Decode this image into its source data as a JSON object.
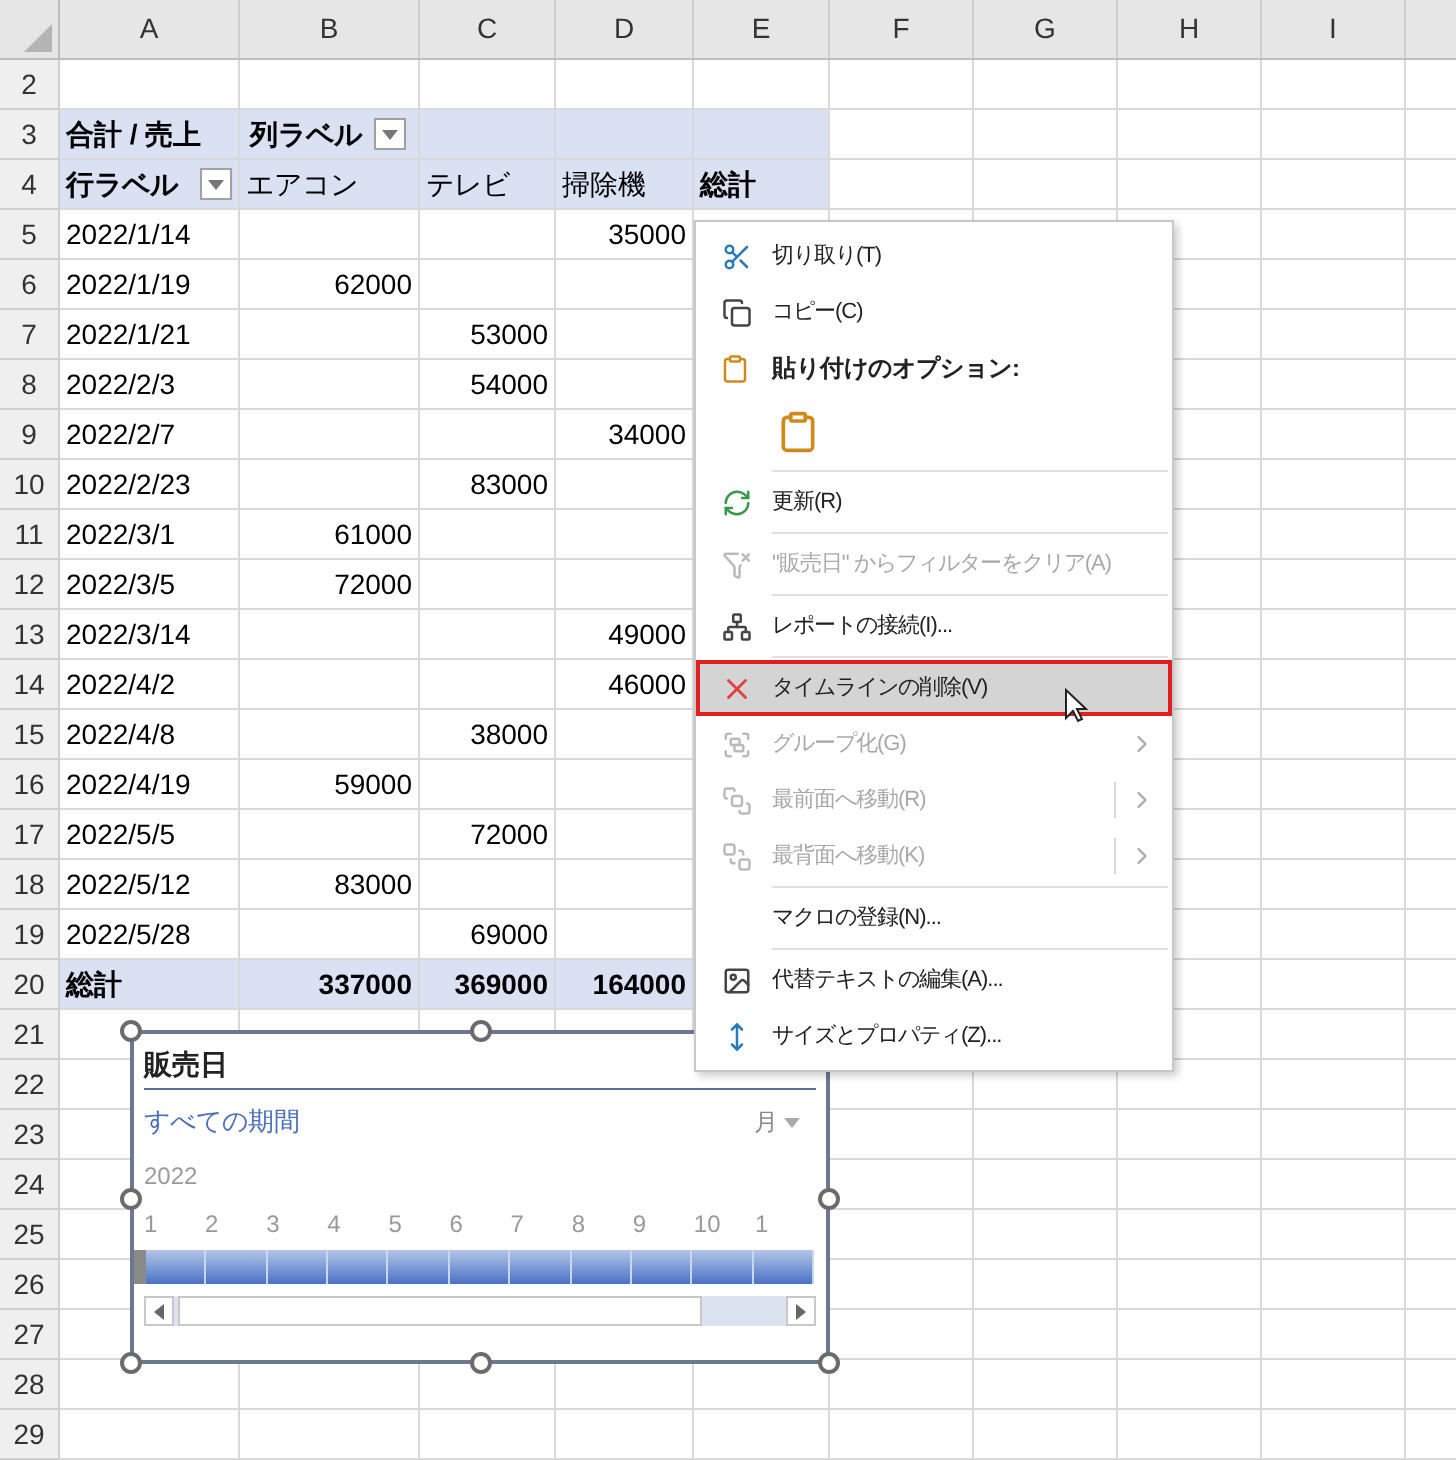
{
  "sheet": {
    "columns": [
      "A",
      "B",
      "C",
      "D",
      "E",
      "F",
      "G",
      "H",
      "I"
    ],
    "row_numbers": [
      "2",
      "3",
      "4",
      "5",
      "6",
      "7",
      "8",
      "9",
      "10",
      "11",
      "12",
      "13",
      "14",
      "15",
      "16",
      "17",
      "18",
      "19",
      "20",
      "21",
      "22",
      "23",
      "24",
      "25",
      "26",
      "27",
      "28",
      "29"
    ],
    "pivot": {
      "value_label": "合計 / 売上",
      "column_label": "列ラベル",
      "row_label": "行ラベル",
      "categories": [
        "エアコン",
        "テレビ",
        "掃除機",
        "総計"
      ],
      "rows": [
        {
          "date": "2022/1/14",
          "vacuum": "35000"
        },
        {
          "date": "2022/1/19",
          "air_conditioner": "62000"
        },
        {
          "date": "2022/1/21",
          "tv": "53000"
        },
        {
          "date": "2022/2/3",
          "tv": "54000"
        },
        {
          "date": "2022/2/7",
          "vacuum": "34000"
        },
        {
          "date": "2022/2/23",
          "tv": "83000"
        },
        {
          "date": "2022/3/1",
          "air_conditioner": "61000"
        },
        {
          "date": "2022/3/5",
          "air_conditioner": "72000"
        },
        {
          "date": "2022/3/14",
          "vacuum": "49000"
        },
        {
          "date": "2022/4/2",
          "vacuum": "46000"
        },
        {
          "date": "2022/4/8",
          "tv": "38000"
        },
        {
          "date": "2022/4/19",
          "air_conditioner": "59000"
        },
        {
          "date": "2022/5/5",
          "tv": "72000"
        },
        {
          "date": "2022/5/12",
          "air_conditioner": "83000"
        },
        {
          "date": "2022/5/28",
          "tv": "69000"
        }
      ],
      "total": {
        "label": "総計",
        "air_conditioner": "337000",
        "tv": "369000",
        "vacuum": "164000"
      }
    }
  },
  "timeline": {
    "title": "販売日",
    "period": "すべての期間",
    "unit": "月",
    "year": "2022",
    "months": [
      "1",
      "2",
      "3",
      "4",
      "5",
      "6",
      "7",
      "8",
      "9",
      "10",
      "1"
    ]
  },
  "context_menu": {
    "items": [
      {
        "kind": "item",
        "label": "切り取り(T)",
        "disabled": false,
        "selected": false
      },
      {
        "kind": "item",
        "label": "コピー(C)",
        "disabled": false,
        "selected": false
      },
      {
        "kind": "heading",
        "label": "貼り付けのオプション:"
      },
      {
        "kind": "paste_options"
      },
      {
        "kind": "separator"
      },
      {
        "kind": "item",
        "label": "更新(R)",
        "disabled": false,
        "selected": false
      },
      {
        "kind": "separator"
      },
      {
        "kind": "item",
        "label": "\"販売日\" からフィルターをクリア(A)",
        "disabled": true,
        "selected": false
      },
      {
        "kind": "separator"
      },
      {
        "kind": "item",
        "label": "レポートの接続(I)...",
        "disabled": false,
        "selected": false
      },
      {
        "kind": "separator"
      },
      {
        "kind": "item",
        "label": "タイムラインの削除(V)",
        "disabled": false,
        "selected": true
      },
      {
        "kind": "item",
        "label": "グループ化(G)",
        "disabled": true,
        "selected": false,
        "submenu": true,
        "split": false
      },
      {
        "kind": "item",
        "label": "最前面へ移動(R)",
        "disabled": true,
        "selected": false,
        "submenu": true,
        "split": true
      },
      {
        "kind": "item",
        "label": "最背面へ移動(K)",
        "disabled": true,
        "selected": false,
        "submenu": true,
        "split": true
      },
      {
        "kind": "separator"
      },
      {
        "kind": "item",
        "label": "マクロの登録(N)...",
        "disabled": false,
        "selected": false
      },
      {
        "kind": "separator"
      },
      {
        "kind": "item",
        "label": "代替テキストの編集(A)...",
        "disabled": false,
        "selected": false
      },
      {
        "kind": "item",
        "label": "サイズとプロパティ(Z)...",
        "disabled": false,
        "selected": false
      }
    ]
  }
}
